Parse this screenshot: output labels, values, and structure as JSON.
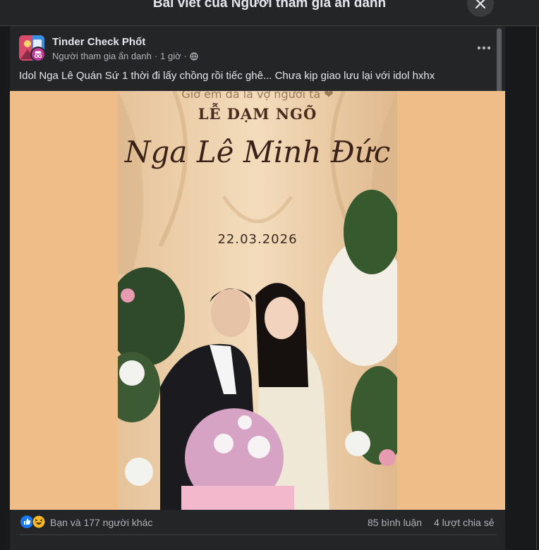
{
  "modal": {
    "title": "Bài viết của Người tham gia ẩn danh"
  },
  "post": {
    "group_name": "Tinder Check Phốt",
    "author": "Người tham gia ẩn danh",
    "separator": "·",
    "time": "1 giờ",
    "privacy_icon": "globe-icon",
    "text": "Idol Nga Lê Quán Sứ 1 thời đi lấy chồng rồi tiếc ghê... Chưa kịp giao lưu lại với idol hxhx"
  },
  "photo": {
    "caption_top": "Giờ em đã là vợ người ta ❤",
    "ceremony": "LỄ DẠM NGÕ",
    "names": "Nga Lê  Minh Đức",
    "date": "22.03.2026"
  },
  "reactions": {
    "summary": "Bạn và 177 người khác",
    "comments": "85 bình luận",
    "shares": "4 lượt chia sẻ",
    "icons": [
      "like-icon",
      "haha-icon"
    ]
  },
  "colors": {
    "background": "#18191a",
    "panel": "#242526",
    "primary_text": "#e4e6eb",
    "secondary_text": "#b0b3b8",
    "photo_backdrop": "#efbe88",
    "like_blue": "#1877f2",
    "haha_yellow": "#f7b928"
  }
}
